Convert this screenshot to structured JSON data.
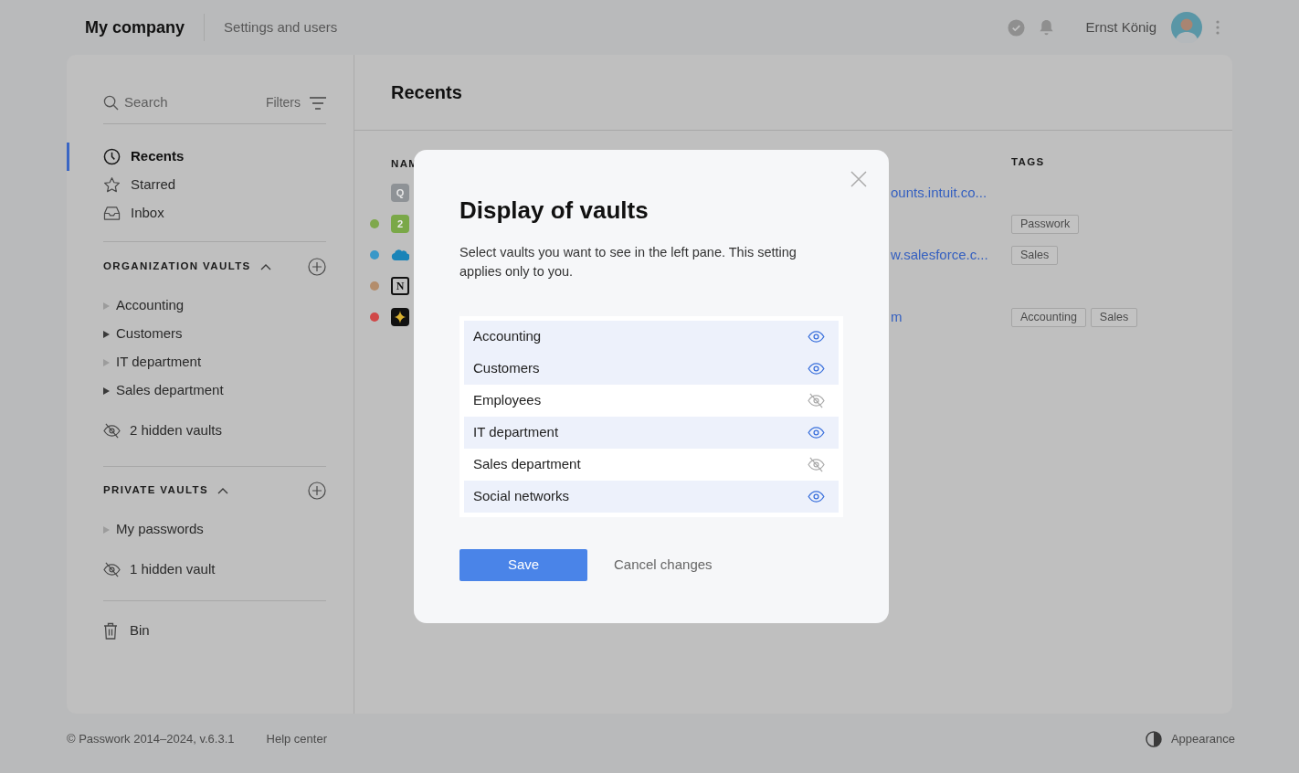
{
  "header": {
    "company": "My company",
    "settings_link": "Settings and users",
    "user_name": "Ernst König"
  },
  "sidebar": {
    "search_placeholder": "Search",
    "filters": "Filters",
    "nav": [
      {
        "label": "Recents",
        "selected": true
      },
      {
        "label": "Starred",
        "selected": false
      },
      {
        "label": "Inbox",
        "selected": false
      }
    ],
    "sections": [
      {
        "title": "ORGANIZATION VAULTS",
        "vaults": [
          {
            "label": "Accounting",
            "expandable": false
          },
          {
            "label": "Customers",
            "expandable": true
          },
          {
            "label": "IT department",
            "expandable": false
          },
          {
            "label": "Sales department",
            "expandable": true
          }
        ],
        "hidden": "2 hidden vaults"
      },
      {
        "title": "PRIVATE VAULTS",
        "vaults": [
          {
            "label": "My passwords",
            "expandable": false
          }
        ],
        "hidden": "1 hidden vault"
      }
    ],
    "bin": "Bin"
  },
  "main": {
    "title": "Recents",
    "columns": {
      "name": "NAM",
      "tags": "TAGS"
    },
    "rows": [
      {
        "icon": {
          "kind": "gray-letter",
          "text": "Q"
        },
        "url": "ounts.intuit.co...",
        "tags": []
      },
      {
        "color": "#7fa84c",
        "icon": {
          "kind": "green-letter",
          "text": "2"
        },
        "tags": [
          "Passwork"
        ]
      },
      {
        "color": "#3a98c8",
        "icon": {
          "kind": "cloud"
        },
        "url": "w.salesforce.c...",
        "tags": [
          "Sales"
        ]
      },
      {
        "color": "#b38d6c",
        "icon": {
          "kind": "boxed-letter",
          "text": "N"
        },
        "tags": []
      },
      {
        "color": "#d04848",
        "icon": {
          "kind": "spark"
        },
        "url": "m",
        "tags": [
          "Accounting",
          "Sales"
        ]
      }
    ]
  },
  "dialog": {
    "title": "Display of vaults",
    "description": "Select vaults you want to see in the left pane. This setting applies only to you.",
    "vaults": [
      {
        "label": "Accounting",
        "visible": true
      },
      {
        "label": "Customers",
        "visible": true
      },
      {
        "label": "Employees",
        "visible": false
      },
      {
        "label": "IT department",
        "visible": true
      },
      {
        "label": "Sales department",
        "visible": false
      },
      {
        "label": "Social networks",
        "visible": true
      }
    ],
    "save": "Save",
    "cancel": "Cancel changes"
  },
  "footer": {
    "copyright": "© Passwork 2014–2024, v.6.3.1",
    "help": "Help center",
    "appearance": "Appearance"
  }
}
